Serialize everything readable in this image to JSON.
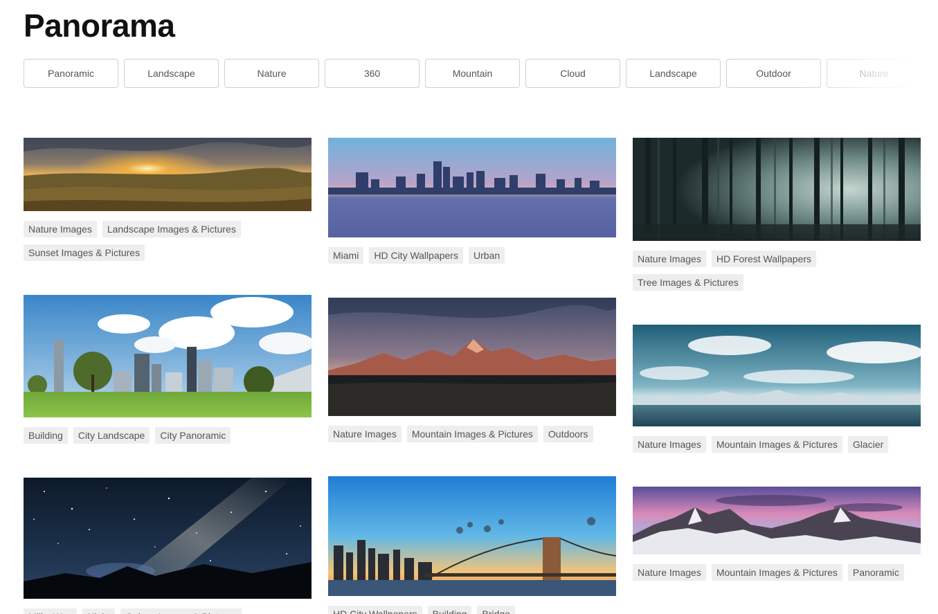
{
  "header": {
    "title": "Panorama"
  },
  "filters": [
    "Panoramic",
    "Landscape",
    "Nature",
    "360",
    "Mountain",
    "Cloud",
    "Landscape",
    "Outdoor",
    "Nature"
  ],
  "photos": [
    {
      "subject": "sunset-meadow",
      "tags": [
        "Nature Images",
        "Landscape Images & Pictures",
        "Sunset Images & Pictures"
      ]
    },
    {
      "subject": "miami-skyline",
      "tags": [
        "Miami",
        "HD City Wallpapers",
        "Urban"
      ]
    },
    {
      "subject": "misty-forest",
      "tags": [
        "Nature Images",
        "HD Forest Wallpapers",
        "Tree Images & Pictures"
      ]
    },
    {
      "subject": "austin-skyline-park",
      "tags": [
        "Building",
        "City Landscape",
        "City Panoramic"
      ]
    },
    {
      "subject": "teton-mountains-dusk",
      "tags": [
        "Nature Images",
        "Mountain Images & Pictures",
        "Outdoors"
      ]
    },
    {
      "subject": "glacier-lake",
      "tags": [
        "Nature Images",
        "Mountain Images & Pictures",
        "Glacier"
      ]
    },
    {
      "subject": "milky-way-night",
      "tags": [
        "Milky Way",
        "Night",
        "Galaxy Images & Pictures"
      ]
    },
    {
      "subject": "brooklyn-bridge",
      "tags": [
        "HD City Wallpapers",
        "Building",
        "Bridge"
      ]
    },
    {
      "subject": "snowy-peaks-sunset",
      "tags": [
        "Nature Images",
        "Mountain Images & Pictures",
        "Panoramic"
      ]
    }
  ],
  "colors": {
    "tag_bg": "#eeeeee",
    "tag_text": "#555555",
    "chip_border": "#cfcfcf"
  }
}
